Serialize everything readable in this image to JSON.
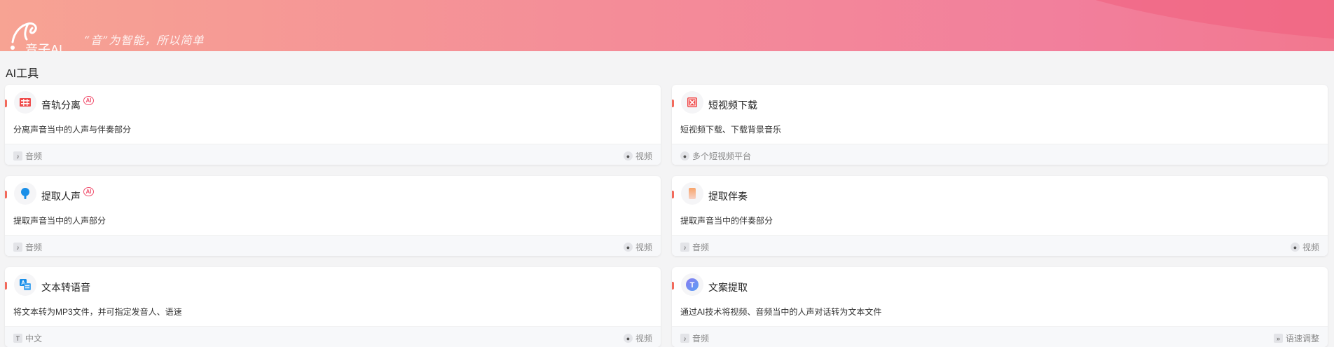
{
  "header": {
    "brand": "音子AI",
    "slogan": "“音”为智能，所以简单"
  },
  "section": {
    "title": "AI工具"
  },
  "cards": [
    {
      "title": "音轨分离",
      "ai": "AI",
      "desc": "分离声音当中的人声与伴奏部分",
      "left_tag": "音频",
      "right_tag": "视频"
    },
    {
      "title": "短视频下载",
      "desc": "短视频下载、下载背景音乐",
      "left_tag": "多个短视频平台"
    },
    {
      "title": "提取人声",
      "ai": "AI",
      "desc": "提取声音当中的人声部分",
      "left_tag": "音频",
      "right_tag": "视频"
    },
    {
      "title": "提取伴奏",
      "desc": "提取声音当中的伴奏部分",
      "left_tag": "音频",
      "right_tag": "视频"
    },
    {
      "title": "文本转语音",
      "desc": "将文本转为MP3文件，并可指定发音人、语速",
      "left_tag": "中文",
      "right_tag": "视频"
    },
    {
      "title": "文案提取",
      "desc": "通过AI技术将视频、音频当中的人声对话转为文本文件",
      "left_tag": "音频",
      "right_tag": "语速调整"
    }
  ],
  "icons": {
    "logo": "yinzi-logo-icon",
    "audio": "music-note-icon",
    "video": "video-icon",
    "platform": "platform-icon",
    "text": "text-icon",
    "speed": "speed-icon"
  },
  "colors": {
    "accent": "#f26a5c",
    "ai_badge": "#f0506e",
    "header_start": "#f7a393",
    "header_end": "#f2788f"
  }
}
